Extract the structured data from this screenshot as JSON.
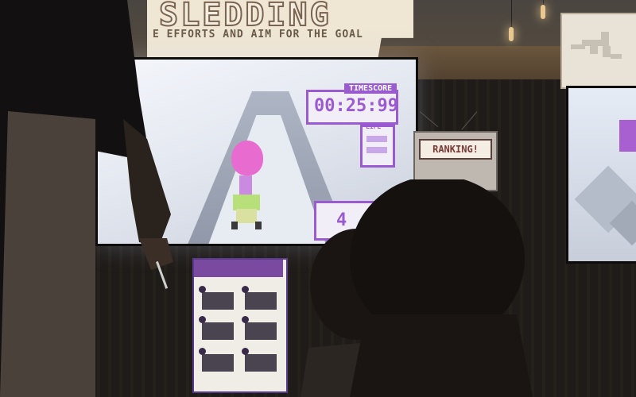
{
  "banner": {
    "title": "SLEDDING",
    "subtitle": "E EFFORTS AND AIM FOR THE GOAL"
  },
  "game_hud": {
    "timescore_label": "TIMESCORE",
    "time": "00:25:99",
    "life_label": "LIFE",
    "score_partial": "4"
  },
  "ranking_sign": {
    "label": "RANKING!"
  },
  "colors": {
    "hud_purple": "#9a5ad0",
    "balloon_pink": "#e86bd0",
    "banner_cream": "#efe6d4"
  }
}
